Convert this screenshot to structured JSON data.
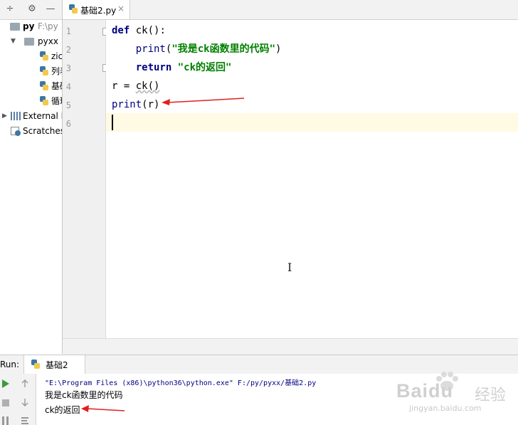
{
  "project": {
    "root": {
      "name": "py",
      "path": "F:\\py"
    },
    "folder": {
      "name": "pyxx"
    },
    "files": [
      "zic",
      "列表",
      "基础",
      "循环"
    ],
    "external_libraries": "External L",
    "scratches": "Scratches"
  },
  "editor": {
    "tab": {
      "label": "基础2.py",
      "close": "×"
    },
    "line_numbers": [
      "1",
      "2",
      "3",
      "4",
      "5",
      "6"
    ],
    "code": {
      "l1_kw": "def",
      "l1_rest": " ck():",
      "l2_indent": "    ",
      "l2_fn": "print",
      "l2_open": "(",
      "l2_str": "\"我是ck函数里的代码\"",
      "l2_close": ")",
      "l3_indent": "    ",
      "l3_kw": "return",
      "l3_sp": " ",
      "l3_str": "\"ck的返回\"",
      "l4_pre": "r = ",
      "l4_call": "ck()",
      "l5_fn": "print",
      "l5_rest": "(r)"
    }
  },
  "run": {
    "label": "Run:",
    "tab": "基础2",
    "command": "\"E:\\Program Files (x86)\\python36\\python.exe\" F:/py/pyxx/基础2.py",
    "output": [
      "我是ck函数里的代码",
      "ck的返回"
    ]
  },
  "watermark": {
    "brand": "Baidu",
    "cn": "经验",
    "url": "jingyan.baidu.com"
  },
  "colors": {
    "keyword": "#000080",
    "string": "#008000",
    "current_line": "#fffae3",
    "arrow": "#e02020"
  }
}
